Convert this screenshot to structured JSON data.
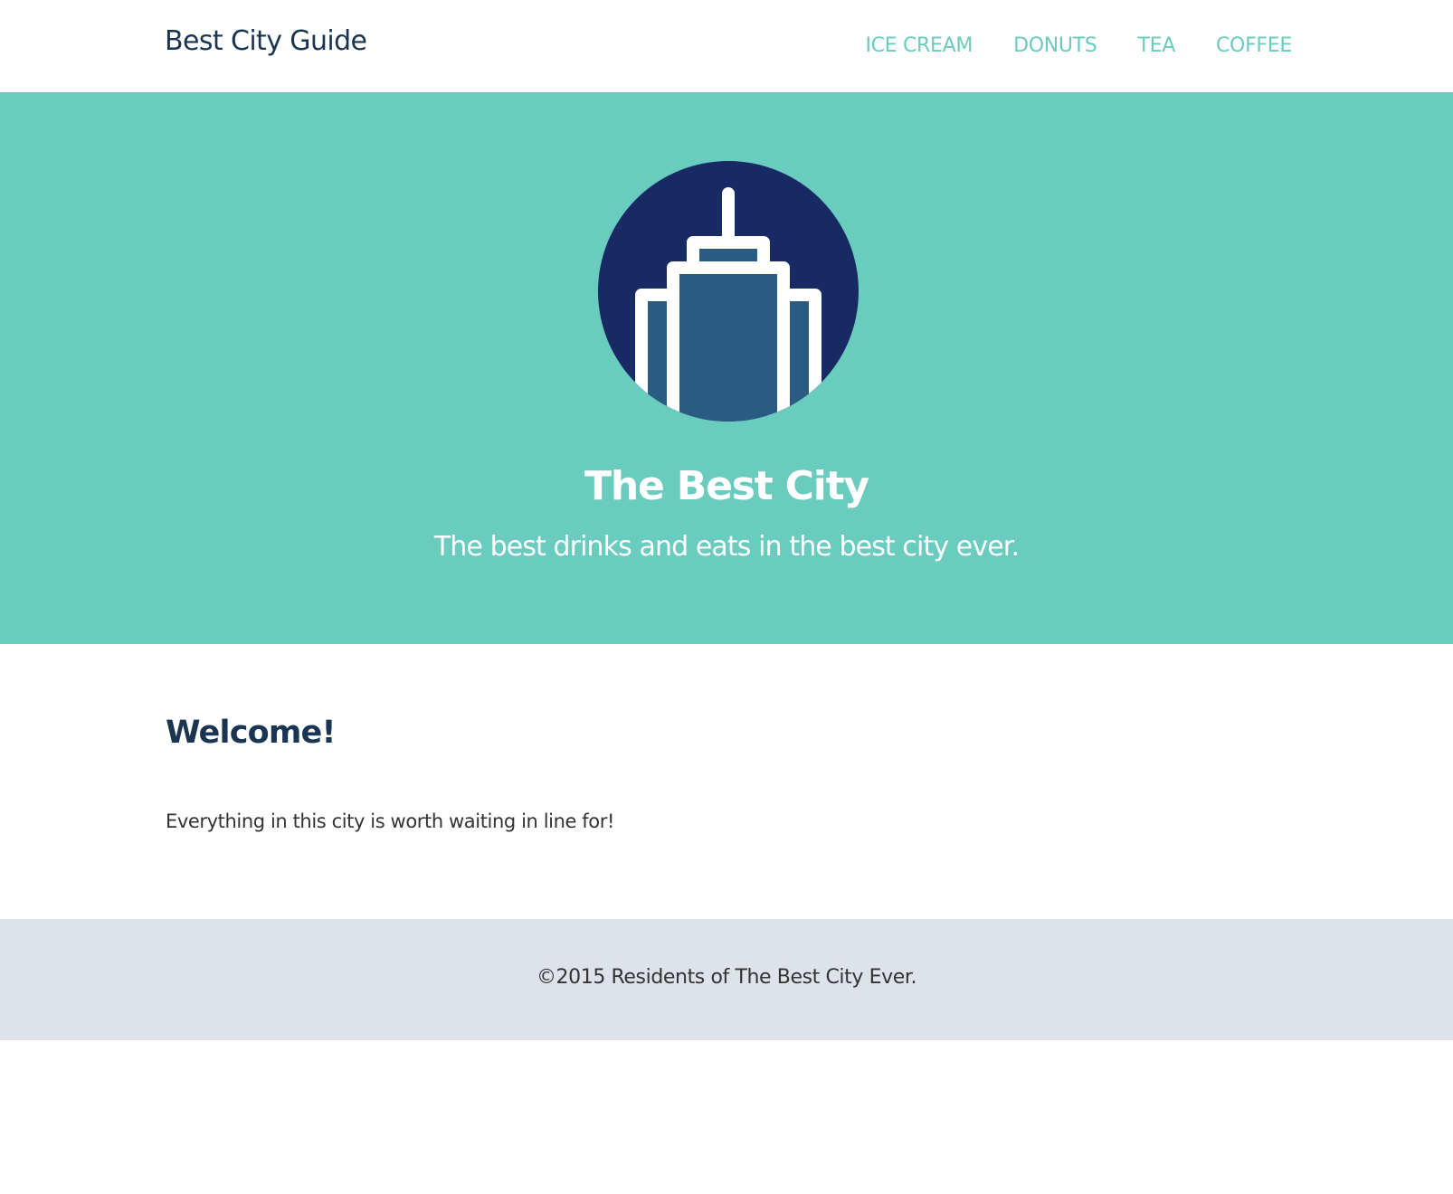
{
  "navbar": {
    "brand": "Best City Guide",
    "links": [
      {
        "label": "ICE CREAM"
      },
      {
        "label": "DONUTS"
      },
      {
        "label": "TEA"
      },
      {
        "label": "COFFEE"
      }
    ]
  },
  "hero": {
    "logo_icon": "skyscraper-logo-icon",
    "title": "The Best City",
    "subtitle": "The best drinks and eats in the best city ever."
  },
  "main": {
    "heading": "Welcome!",
    "text": "Everything in this city is worth waiting in line for!"
  },
  "footer": {
    "text": "©2015 Residents of The Best City Ever."
  },
  "colors": {
    "brand_navy": "#1a3552",
    "accent_teal": "#6acbbf",
    "logo_circle": "#172a63",
    "logo_building": "#2a5b82",
    "footer_bg": "#dde3e9"
  }
}
